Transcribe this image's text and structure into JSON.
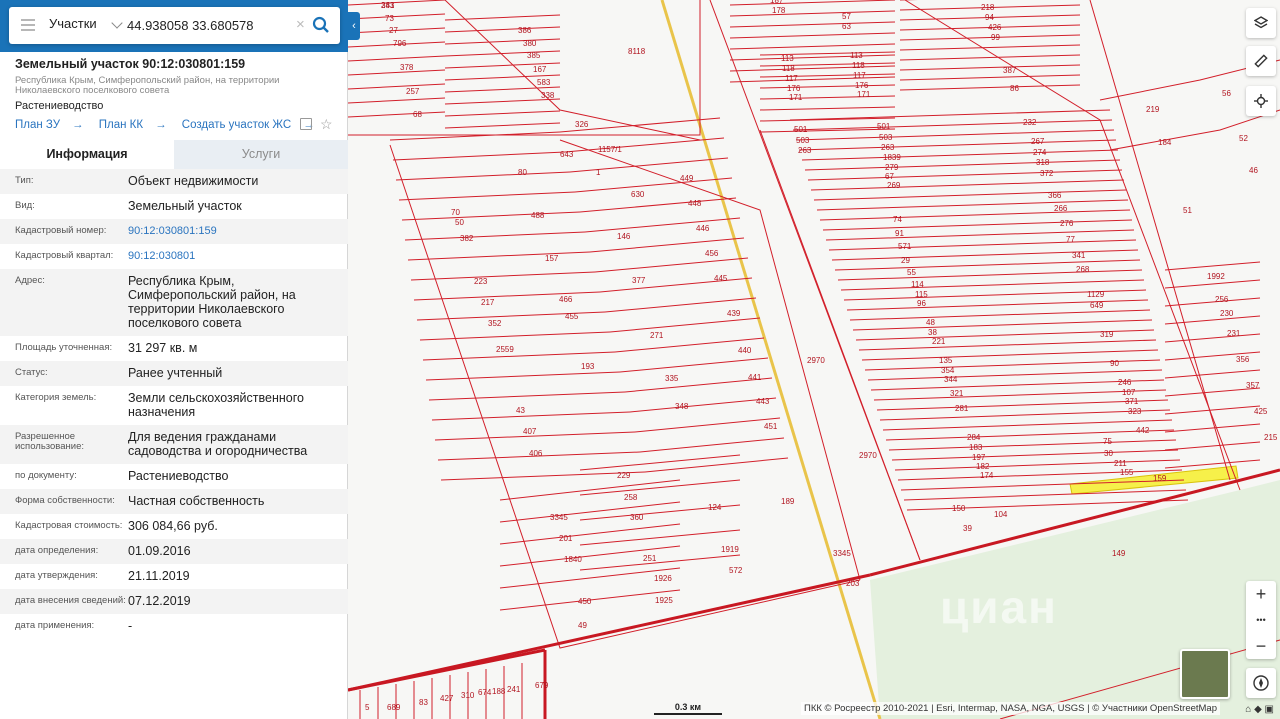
{
  "search": {
    "layer": "Участки",
    "query": "44.938058 33.680578"
  },
  "parcel": {
    "title": "Земельный участок 90:12:030801:159",
    "address_short": "Республика Крым, Симферопольский район, на территории Николаевского поселкового совета",
    "purpose": "Растениеводство",
    "links": [
      "План ЗУ",
      "План КК",
      "Создать участок ЖС"
    ]
  },
  "tabs": {
    "info": "Информация",
    "services": "Услуги"
  },
  "info_rows": [
    {
      "k": "Тип:",
      "v": "Объект недвижимости"
    },
    {
      "k": "Вид:",
      "v": "Земельный участок"
    },
    {
      "k": "Кадастровый номер:",
      "v": "90:12:030801:159",
      "link": true
    },
    {
      "k": "Кадастровый квартал:",
      "v": "90:12:030801",
      "link": true
    },
    {
      "k": "Адрес:",
      "v": "Республика Крым, Симферопольский район, на территории Николаевского поселкового совета"
    },
    {
      "k": "Площадь уточненная:",
      "v": "31 297 кв. м"
    },
    {
      "k": "Статус:",
      "v": "Ранее учтенный"
    },
    {
      "k": "Категория земель:",
      "v": "Земли сельскохозяйственного назначения"
    },
    {
      "k": "Разрешенное использование:",
      "v": "Для ведения гражданами садоводства и огородничества"
    },
    {
      "k": "по документу:",
      "v": "Растениеводство"
    },
    {
      "k": "Форма собственности:",
      "v": "Частная собственность"
    },
    {
      "k": "Кадастровая стоимость:",
      "v": "306 084,66 руб."
    },
    {
      "k": "дата определения:",
      "v": "01.09.2016"
    },
    {
      "k": "дата утверждения:",
      "v": "21.11.2019"
    },
    {
      "k": "дата внесения сведений:",
      "v": "07.12.2019"
    },
    {
      "k": "дата применения:",
      "v": "-"
    }
  ],
  "map": {
    "scale_label": "0.3 км",
    "attribution": "ПКК © Росреестр 2010-2021 | Esri, Intermap, NASA, NGA, USGS | © Участники OpenStreetMap",
    "watermark": "циан",
    "plot_labels": [
      "241",
      "73",
      "27",
      "796",
      "378",
      "257",
      "68",
      "386",
      "380",
      "385",
      "167",
      "583",
      "338",
      "326",
      "8118",
      "187",
      "178",
      "57",
      "63",
      "218",
      "94",
      "426",
      "99",
      "113",
      "118",
      "117",
      "176",
      "171",
      "113",
      "118",
      "117",
      "176",
      "171",
      "387",
      "86",
      "219",
      "56",
      "184",
      "52",
      "46",
      "51",
      "501",
      "503",
      "263",
      "501",
      "503",
      "263",
      "1839",
      "279",
      "67",
      "269",
      "232",
      "267",
      "274",
      "318",
      "372",
      "366",
      "266",
      "276",
      "77",
      "341",
      "268",
      "1129",
      "649",
      "319",
      "90",
      "246",
      "107",
      "371",
      "323",
      "442",
      "75",
      "30",
      "211",
      "155",
      "159",
      "1157/1",
      "643",
      "1",
      "630",
      "80",
      "449",
      "448",
      "446",
      "456",
      "445",
      "439",
      "440",
      "441",
      "443",
      "451",
      "70",
      "50",
      "382",
      "488",
      "146",
      "157",
      "377",
      "223",
      "217",
      "352",
      "466",
      "455",
      "271",
      "335",
      "348",
      "2559",
      "193",
      "43",
      "407",
      "406",
      "2970",
      "2970",
      "74",
      "91",
      "571",
      "29",
      "55",
      "114",
      "115",
      "96",
      "48",
      "38",
      "221",
      "135",
      "354",
      "344",
      "321",
      "281",
      "284",
      "183",
      "197",
      "182",
      "174",
      "150",
      "104",
      "39",
      "149",
      "1992",
      "256",
      "230",
      "231",
      "356",
      "357",
      "425",
      "215",
      "229",
      "258",
      "360",
      "124",
      "189",
      "3345",
      "3345",
      "201",
      "1840",
      "251",
      "1926",
      "1925",
      "1919",
      "572",
      "450",
      "49",
      "203",
      "5",
      "689",
      "83",
      "427",
      "310",
      "674",
      "188",
      "241",
      "679",
      "383"
    ]
  },
  "controls": {
    "layers_icon": "layers-icon",
    "ruler_icon": "ruler-icon",
    "locate_icon": "locate-icon",
    "zoom_in": "+",
    "zoom_more": "•••",
    "zoom_out": "−"
  }
}
